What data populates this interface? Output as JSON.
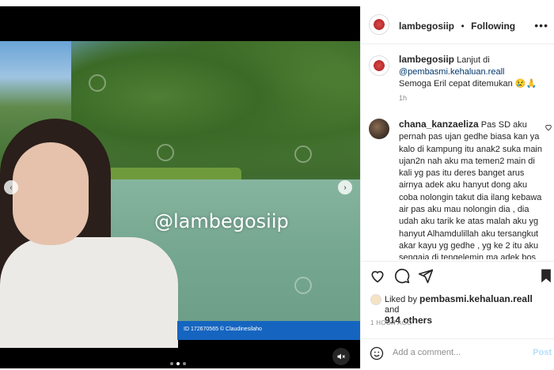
{
  "media": {
    "overlay_handle": "@lambegosiip",
    "credit": "ID 172670565 © Claudinesilaho",
    "carousel_index": 1,
    "carousel_count": 3
  },
  "header": {
    "username": "lambegosiip",
    "separator": "•",
    "follow_status": "Following",
    "more_icon": "more-horizontal-icon"
  },
  "caption": {
    "username": "lambegosiip",
    "text_before": "Lanjut di",
    "mention": "@pembasmi.kehaluan.reall",
    "text_after": "Semoga Eril cepat ditemukan 😢🙏",
    "time": "1h"
  },
  "comment": {
    "username": "chana_kanzaeliza",
    "text": "Pas SD aku pernah pas ujan gedhe biasa kan ya kalo di kampung itu anak2 suka main ujan2n nah aku ma temen2 main di kali yg pas itu deres banget arus airnya adek aku hanyut dong aku coba nolongin takut dia ilang kebawa air pas aku mau nolongin dia , dia udah aku tarik ke atas malah aku yg hanyut Alhamdulillah aku tersangkut akar kayu yg gedhe , yg ke 2 itu aku sengaja di tengelemin ma adek bos aku pas di"
  },
  "likes": {
    "prefix": "Liked by",
    "liker": "pembasmi.kehaluan.reall",
    "and": "and",
    "others": "914 others",
    "ago": "1 HOUR AGO"
  },
  "add_comment": {
    "placeholder": "Add a comment...",
    "post_label": "Post"
  },
  "colors": {
    "link": "#00376b",
    "muted": "#8e8e8e",
    "post_disabled": "#b2dffc",
    "credit_bar": "#1565c0"
  }
}
